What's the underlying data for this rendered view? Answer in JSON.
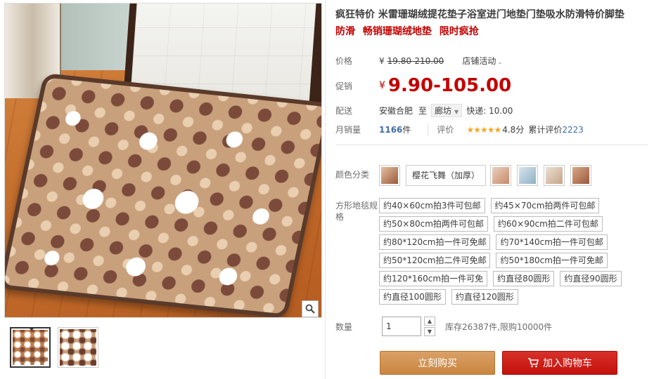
{
  "product": {
    "title": "疯狂特价 米雷珊瑚绒提花垫子浴室进门地垫门垫吸水防滑特价脚垫",
    "tags": [
      "防滑",
      "畅销珊瑚绒地垫",
      "限时疯抢"
    ]
  },
  "price": {
    "label": "价格",
    "currency": "¥",
    "original": "19.80-210.00",
    "store_activity": "店铺活动"
  },
  "promo": {
    "label": "促销",
    "currency": "¥",
    "price": "9.90-105.00"
  },
  "shipping": {
    "label": "配送",
    "from": "安徽合肥",
    "to_word": "至",
    "city": "廊坊",
    "express": "快递: 10.00"
  },
  "sales": {
    "label": "月销量",
    "count": "1166",
    "unit": "件",
    "rating_label": "评价",
    "stars": "★★★★★",
    "score": "4.8分",
    "total_prefix": "累计评价",
    "total_count": "2223"
  },
  "color": {
    "label": "颜色分类",
    "selected_text": "樱花飞舞（加厚）",
    "swatch_colors": [
      "#b06a3a",
      "#c98a66",
      "#8fb0c4",
      "#c4a488",
      "#9a5a3c"
    ]
  },
  "size": {
    "label": "方形地毯规格",
    "options": [
      "约40×60cm拍3件可包邮",
      "约45×70cm拍两件可包邮",
      "约50×80cm拍两件可包邮",
      "约60×90cm拍二件可包邮",
      "约80*120cm拍一件可免邮",
      "约70*140cm拍一件可包邮",
      "约50*120cm拍二件可免邮",
      "约50*180cm拍一件可免邮",
      "约120*160cm拍一件可免",
      "约直径80圆形",
      "约直径90圆形",
      "约直径100圆形",
      "约直径120圆形"
    ]
  },
  "quantity": {
    "label": "数量",
    "value": "1",
    "stock": "库存26387件,限购10000件"
  },
  "actions": {
    "buy_now": "立刻购买",
    "add_to_cart": "加入购物车"
  }
}
